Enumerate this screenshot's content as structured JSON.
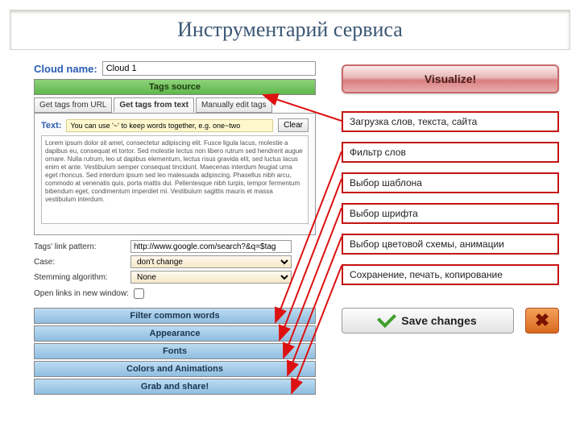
{
  "page_title": "Инструментарий сервиса",
  "cloud_name_label": "Cloud name:",
  "cloud_name_value": "Cloud 1",
  "tags_source_header": "Tags source",
  "tabs": {
    "url": "Get tags from URL",
    "text": "Get tags from text",
    "manual": "Manually edit tags"
  },
  "text_label": "Text:",
  "hint": "You can use '~' to keep words together, e.g. one~two",
  "clear_label": "Clear",
  "lorem": "Lorem ipsum dolor sit amet, consectetur adipiscing elit. Fusce ligula lacus, molestie a dapibus eu, consequat et tortor. Sed molestie lectus non libero rutrum sed hendrerit augue ornare. Nulla rutrum, leo ut dapibus elementum, lectus risus gravida elit, sed luctus lacus enim et ante. Vestibulum semper consequat tincidunt. Maecenas interdum feugiat urna eget rhoncus. Sed interdum ipsum sed leo malesuada adipiscing. Phasellus nibh arcu, commodo at venenatis quis, porta mattis dui. Pellentesque nibh turpis, tempor fermentum bibendum eget, condimentum imperdiet mi. Vestibulum sagittis mauris et massa vestibulum interdum.",
  "opts": {
    "link_pattern_label": "Tags' link pattern:",
    "link_pattern_value": "http://www.google.com/search?&q=$tag",
    "case_label": "Case:",
    "case_value": "don't change",
    "stem_label": "Stemming algorithm:",
    "stem_value": "None",
    "newwin_label": "Open links in new window:"
  },
  "accordion": {
    "filter": "Filter common words",
    "appearance": "Appearance",
    "fonts": "Fonts",
    "colors": "Colors and Animations",
    "grab": "Grab and share!"
  },
  "visualize_label": "Visualize!",
  "annotations": {
    "a1": "Загрузка слов, текста, сайта",
    "a2": "Фильтр слов",
    "a3": "Выбор шаблона",
    "a4": "Выбор шрифта",
    "a5": "Выбор цветовой схемы, анимации",
    "a6": "Сохранение, печать, копирование"
  },
  "save_label": "Save changes"
}
